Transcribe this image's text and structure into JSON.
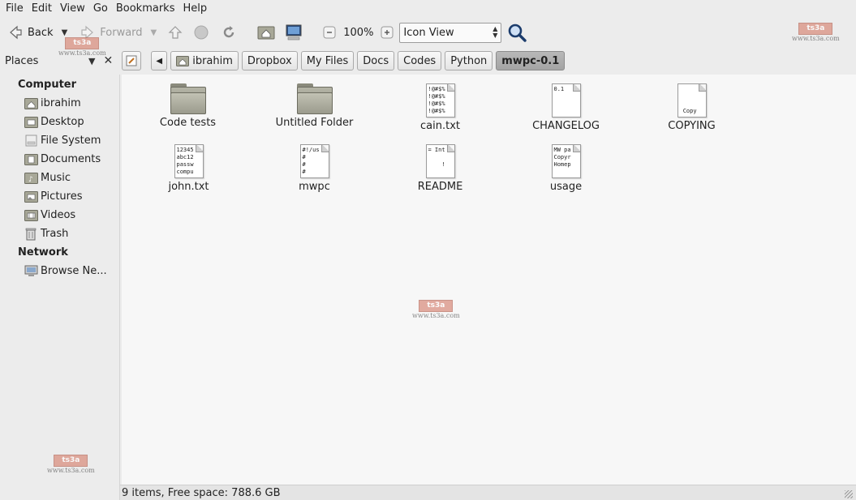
{
  "menubar": {
    "items": [
      "File",
      "Edit",
      "View",
      "Go",
      "Bookmarks",
      "Help"
    ]
  },
  "toolbar": {
    "back_label": "Back",
    "forward_label": "Forward",
    "zoom": "100%",
    "view_mode": "Icon View"
  },
  "locationbar": {
    "places_label": "Places",
    "breadcrumbs": [
      "ibrahim",
      "Dropbox",
      "My Files",
      "Docs",
      "Codes",
      "Python",
      "mwpc-0.1"
    ],
    "active_index": 6
  },
  "sidebar": {
    "computer_header": "Computer",
    "computer_items": [
      {
        "label": "ibrahim",
        "icon": "home-folder-icon"
      },
      {
        "label": "Desktop",
        "icon": "desktop-folder-icon"
      },
      {
        "label": "File System",
        "icon": "drive-icon"
      },
      {
        "label": "Documents",
        "icon": "documents-folder-icon"
      },
      {
        "label": "Music",
        "icon": "music-folder-icon"
      },
      {
        "label": "Pictures",
        "icon": "pictures-folder-icon"
      },
      {
        "label": "Videos",
        "icon": "videos-folder-icon"
      },
      {
        "label": "Trash",
        "icon": "trash-icon"
      }
    ],
    "network_header": "Network",
    "network_items": [
      {
        "label": "Browse Ne...",
        "icon": "network-icon"
      }
    ]
  },
  "files": [
    {
      "name": "Code tests",
      "type": "folder"
    },
    {
      "name": "Untitled Folder",
      "type": "folder"
    },
    {
      "name": "cain.txt",
      "type": "text",
      "preview": "!@#$%\n!@#$%\n!@#$%\n!@#$%"
    },
    {
      "name": "CHANGELOG",
      "type": "text",
      "preview": "0.1"
    },
    {
      "name": "COPYING",
      "type": "text",
      "preview": "\n\n\n Copy"
    },
    {
      "name": "john.txt",
      "type": "text",
      "preview": "12345\nabc12\npassw\ncompu"
    },
    {
      "name": "mwpc",
      "type": "text",
      "preview": "#!/us\n#\n#\n#"
    },
    {
      "name": "README",
      "type": "text",
      "preview": "= Int\n\n    !"
    },
    {
      "name": "usage",
      "type": "text",
      "preview": "MW pa\nCopyr\nHomep"
    }
  ],
  "statusbar": {
    "text": "9 items, Free space: 788.6 GB"
  },
  "watermark": {
    "logo_text": "ts3a",
    "url": "www.ts3a.com"
  }
}
